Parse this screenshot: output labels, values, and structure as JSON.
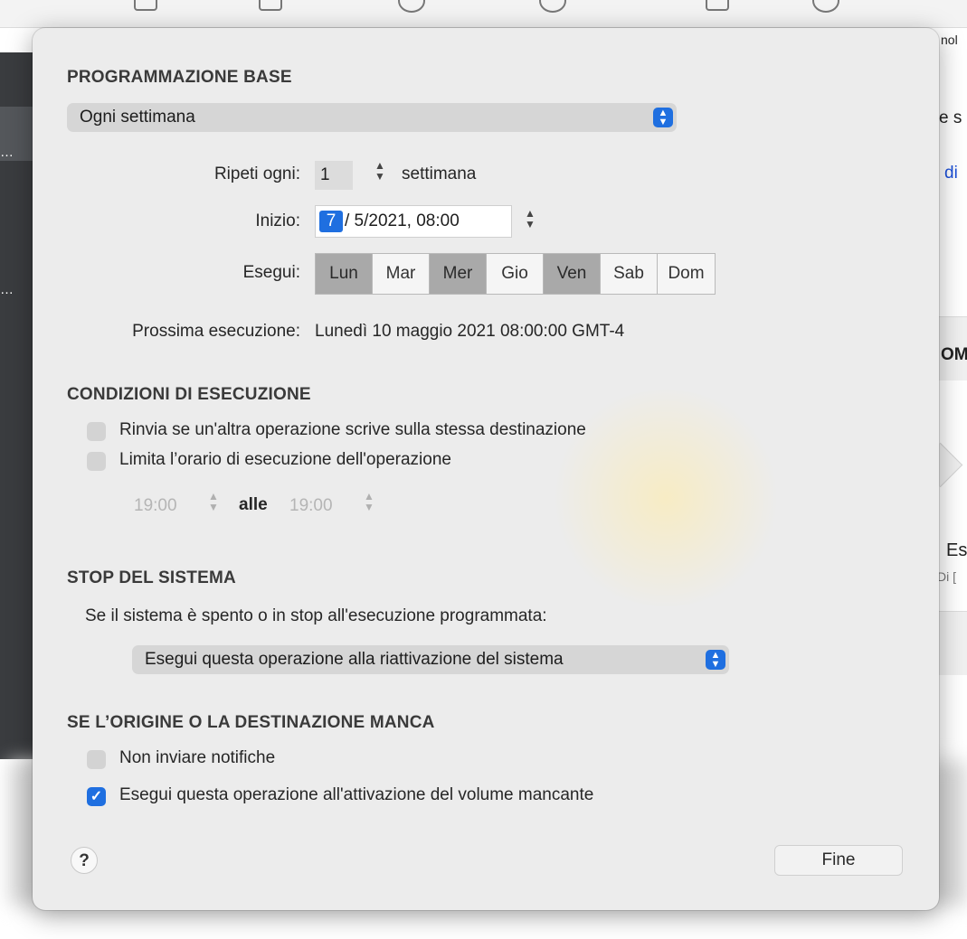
{
  "background": {
    "toolbar_icons": [
      "sidebar-icon",
      "tray-icon",
      "clock-icon",
      "clock-icon",
      "calendar-icon",
      "info-icon"
    ],
    "sidebar_ellipses": [
      "…",
      "…"
    ],
    "right_fragments": {
      "top": "nol",
      "line1": "e s",
      "link": "di",
      "heading": "OM",
      "bold": "Es",
      "small": "Di ["
    }
  },
  "sheet": {
    "base": {
      "heading": "PROGRAMMAZIONE BASE",
      "frequency": "Ogni settimana",
      "repeat_label": "Ripeti ogni:",
      "repeat_value": "1",
      "repeat_unit": "settimana",
      "start_label": "Inizio:",
      "start_day": "7",
      "start_rest": "/ 5/2021, 08:00",
      "run_label": "Esegui:",
      "days": [
        {
          "label": "Lun",
          "selected": true
        },
        {
          "label": "Mar",
          "selected": false
        },
        {
          "label": "Mer",
          "selected": true
        },
        {
          "label": "Gio",
          "selected": false
        },
        {
          "label": "Ven",
          "selected": true
        },
        {
          "label": "Sab",
          "selected": false
        },
        {
          "label": "Dom",
          "selected": false
        }
      ],
      "next_label": "Prossima esecuzione:",
      "next_value": "Lunedì 10 maggio 2021 08:00:00 GMT-4"
    },
    "conditions": {
      "heading": "CONDIZIONI DI ESECUZIONE",
      "postpone_label": "Rinvia se un'altra operazione scrive sulla stessa destinazione",
      "postpone_checked": false,
      "limit_label": "Limita l’orario di esecuzione dell'operazione",
      "limit_checked": false,
      "from_time": "19:00",
      "between_label": "alle",
      "to_time": "19:00"
    },
    "sleep": {
      "heading": "STOP DEL SISTEMA",
      "description": "Se il sistema è spento o in stop all'esecuzione programmata:",
      "action": "Esegui questa operazione alla riattivazione del sistema"
    },
    "missing": {
      "heading": "SE L’ORIGINE O LA DESTINAZIONE MANCA",
      "no_notify_label": "Non inviare notifiche",
      "no_notify_checked": false,
      "run_on_mount_label": "Esegui questa operazione all'attivazione del volume mancante",
      "run_on_mount_checked": true,
      "run_on_mount_mark": "✓"
    },
    "help_label": "?",
    "done_label": "Fine"
  },
  "colors": {
    "accent": "#1f6fe0",
    "sheet_bg": "#ececec",
    "day_selected": "#a9a9a9"
  }
}
